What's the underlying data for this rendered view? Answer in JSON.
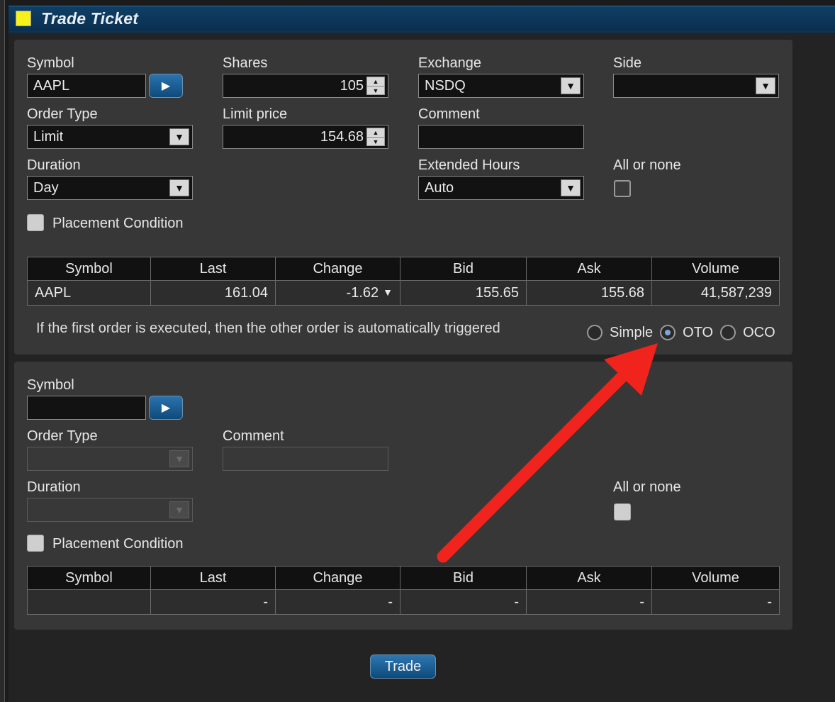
{
  "window": {
    "title": "Trade Ticket",
    "title_swatch_color": "#f7f11a"
  },
  "order1": {
    "symbol_label": "Symbol",
    "symbol_value": "AAPL",
    "shares_label": "Shares",
    "shares_value": "105",
    "exchange_label": "Exchange",
    "exchange_value": "NSDQ",
    "side_label": "Side",
    "side_value": "",
    "order_type_label": "Order Type",
    "order_type_value": "Limit",
    "limit_price_label": "Limit price",
    "limit_price_value": "154.68",
    "comment_label": "Comment",
    "comment_value": "",
    "duration_label": "Duration",
    "duration_value": "Day",
    "extended_hours_label": "Extended Hours",
    "extended_hours_value": "Auto",
    "all_or_none_label": "All or none",
    "all_or_none_checked": false,
    "placement_condition_label": "Placement Condition",
    "placement_condition_checked": false
  },
  "quote_headers": [
    "Symbol",
    "Last",
    "Change",
    "Bid",
    "Ask",
    "Volume"
  ],
  "quote1": {
    "symbol": "AAPL",
    "last": "161.04",
    "change": "-1.62",
    "change_direction": "down",
    "bid": "155.65",
    "ask": "155.68",
    "volume": "41,587,239"
  },
  "order_link": {
    "description": "If the first order is executed, then the other order is automatically triggered",
    "options": [
      "Simple",
      "OTO",
      "OCO"
    ],
    "selected": "OTO"
  },
  "order2": {
    "symbol_label": "Symbol",
    "symbol_value": "",
    "order_type_label": "Order Type",
    "order_type_value": "",
    "comment_label": "Comment",
    "comment_value": "",
    "duration_label": "Duration",
    "duration_value": "",
    "all_or_none_label": "All or none",
    "all_or_none_checked": false,
    "placement_condition_label": "Placement Condition",
    "placement_condition_checked": false
  },
  "quote2": {
    "symbol": "",
    "last": "-",
    "change": "-",
    "bid": "-",
    "ask": "-",
    "volume": "-"
  },
  "trade_button_label": "Trade",
  "annotation": {
    "arrow_color": "#f0231d",
    "points_to": "OTO radio"
  },
  "colors": {
    "negative_change": "#e02828",
    "button_blue": "#1a5f96"
  }
}
